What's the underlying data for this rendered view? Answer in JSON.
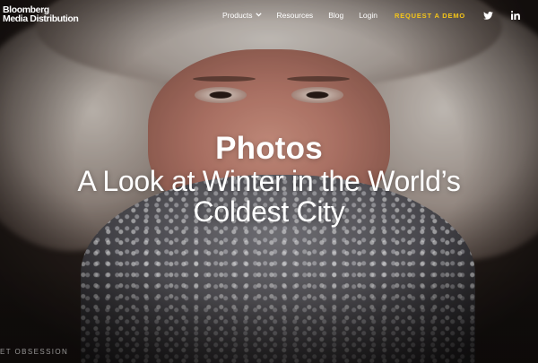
{
  "brand": {
    "line1": "Bloomberg",
    "line2": "Media Distribution"
  },
  "nav": {
    "items": [
      {
        "label": "Products",
        "has_dropdown": true
      },
      {
        "label": "Resources"
      },
      {
        "label": "Blog"
      },
      {
        "label": "Login"
      }
    ],
    "cta": "REQUEST A DEMO",
    "social": [
      "twitter-icon",
      "linkedin-icon"
    ],
    "cta_color": "#f5c518"
  },
  "hero": {
    "kicker": "Photos",
    "headline": "A Look at Winter in the World’s Coldest City",
    "footer_label": "ET OBSESSION",
    "image_alt_semantic": "frost-covered person in fur hood"
  }
}
